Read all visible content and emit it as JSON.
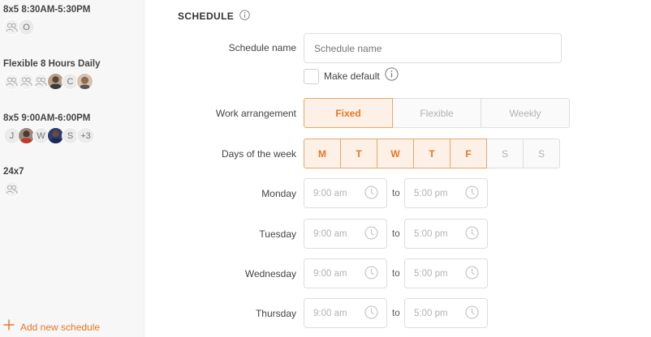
{
  "sidebar": {
    "schedules": [
      {
        "title": "8x5 8:30AM-5:30PM",
        "avatars": [
          {
            "type": "group"
          },
          {
            "type": "initial",
            "text": "O"
          }
        ]
      },
      {
        "title": "Flexible 8 Hours Daily",
        "avatars": [
          {
            "type": "group"
          },
          {
            "type": "group"
          },
          {
            "type": "group"
          },
          {
            "type": "photo"
          },
          {
            "type": "initial",
            "text": "C"
          },
          {
            "type": "photo"
          }
        ]
      },
      {
        "title": "8x5 9:00AM-6:00PM",
        "avatars": [
          {
            "type": "initial",
            "text": "J"
          },
          {
            "type": "photo"
          },
          {
            "type": "initial",
            "text": "W"
          },
          {
            "type": "photo"
          },
          {
            "type": "initial",
            "text": "S"
          },
          {
            "type": "more",
            "text": "+3"
          }
        ]
      },
      {
        "title": "24x7",
        "avatars": [
          {
            "type": "group"
          }
        ]
      }
    ],
    "add_label": "Add new schedule"
  },
  "main": {
    "section_title": "SCHEDULE",
    "schedule_name_label": "Schedule name",
    "schedule_name_placeholder": "Schedule name",
    "make_default_label": "Make default",
    "work_arrangement_label": "Work arrangement",
    "work_arrangement_options": [
      "Fixed",
      "Flexible",
      "Weekly"
    ],
    "work_arrangement_selected": "Fixed",
    "days_label": "Days of the week",
    "days": [
      {
        "label": "M",
        "active": true
      },
      {
        "label": "T",
        "active": true
      },
      {
        "label": "W",
        "active": true
      },
      {
        "label": "T",
        "active": true
      },
      {
        "label": "F",
        "active": true
      },
      {
        "label": "S",
        "active": false
      },
      {
        "label": "S",
        "active": false
      }
    ],
    "to_label": "to",
    "day_rows": [
      {
        "day": "Monday",
        "start": "9:00 am",
        "end": "5:00 pm"
      },
      {
        "day": "Tuesday",
        "start": "9:00 am",
        "end": "5:00 pm"
      },
      {
        "day": "Wednesday",
        "start": "9:00 am",
        "end": "5:00 pm"
      },
      {
        "day": "Thursday",
        "start": "9:00 am",
        "end": "5:00 pm"
      }
    ]
  },
  "colors": {
    "accent": "#e87722",
    "accent_bg": "#fdf1e7",
    "sidebar_bg": "#f7f7f8"
  },
  "icons": [
    "group-icon",
    "info-icon",
    "clock-icon",
    "plus-icon"
  ]
}
